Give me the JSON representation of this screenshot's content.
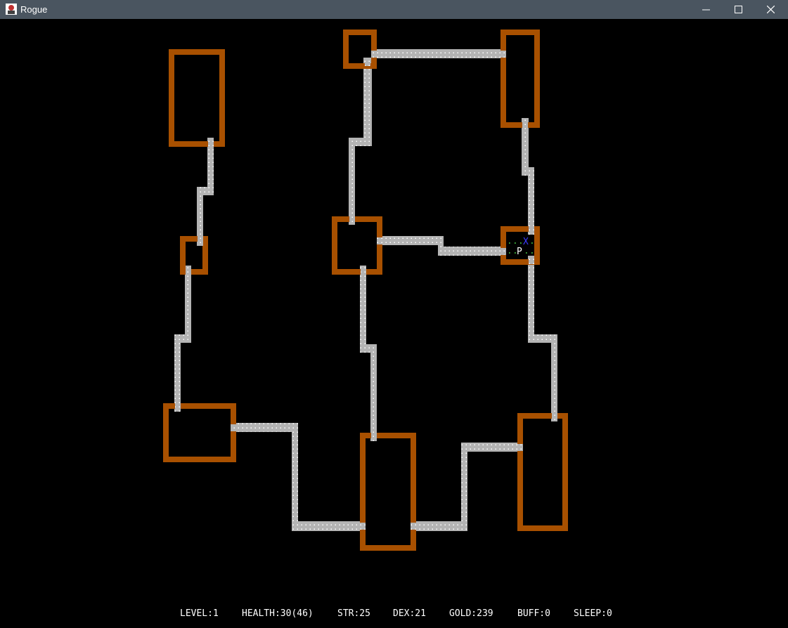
{
  "window": {
    "title": "Rogue",
    "icon": "rogue-app-icon",
    "controls": [
      "minimize-icon",
      "maximize-icon",
      "close-icon"
    ]
  },
  "colors": {
    "background": "#000000",
    "titlebar": "#4a5560",
    "room_wall": "#a85000",
    "corridor": "#b4b4b4",
    "corridor_dot": "#ffffff",
    "floor_dot": "#3cb43c",
    "player": "#ffffff",
    "exit": "#3c3cff",
    "status_text": "#ffffff"
  },
  "map": {
    "tiles": {
      "player": "P",
      "exit": "X",
      "floor_dot": "."
    }
  },
  "status": {
    "level": "LEVEL:1",
    "health": "HEALTH:30(46)",
    "str": "STR:25",
    "dex": "DEX:21",
    "gold": "GOLD:239",
    "buff": "BUFF:0",
    "sleep": "SLEEP:0"
  }
}
